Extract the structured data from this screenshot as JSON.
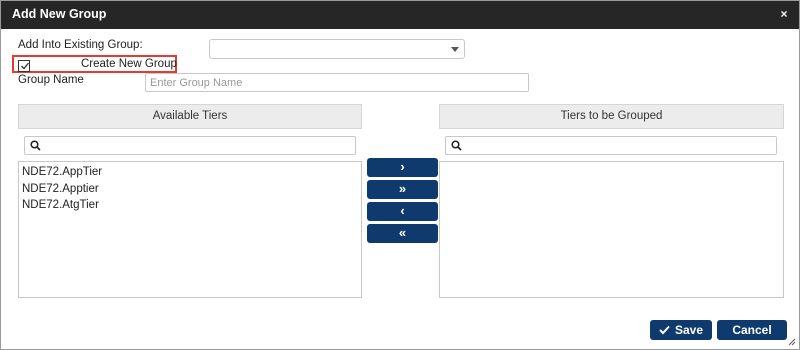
{
  "dialog": {
    "title": "Add New Group",
    "close_symbol": "×"
  },
  "form": {
    "existing_group_label": "Add Into Existing Group:",
    "existing_group_value": "",
    "create_new_group_label": "Create New Group",
    "create_new_group_checked": true,
    "group_name_label": "Group Name",
    "group_name_placeholder": "Enter Group Name",
    "group_name_value": ""
  },
  "available": {
    "header": "Available Tiers",
    "search_value": "",
    "items": [
      {
        "label": "NDE72.AppTier"
      },
      {
        "label": "NDE72.Apptier"
      },
      {
        "label": "NDE72.AtgTier"
      }
    ]
  },
  "grouped": {
    "header": "Tiers to be Grouped",
    "search_value": "",
    "items": []
  },
  "move_buttons": {
    "move_one": "›",
    "move_all": "»",
    "remove_one": "‹",
    "remove_all": "«"
  },
  "actions": {
    "save_label": "Save",
    "cancel_label": "Cancel"
  },
  "colors": {
    "titlebar": "#262626",
    "button": "#0e3a6e",
    "highlight": "#e53935"
  }
}
